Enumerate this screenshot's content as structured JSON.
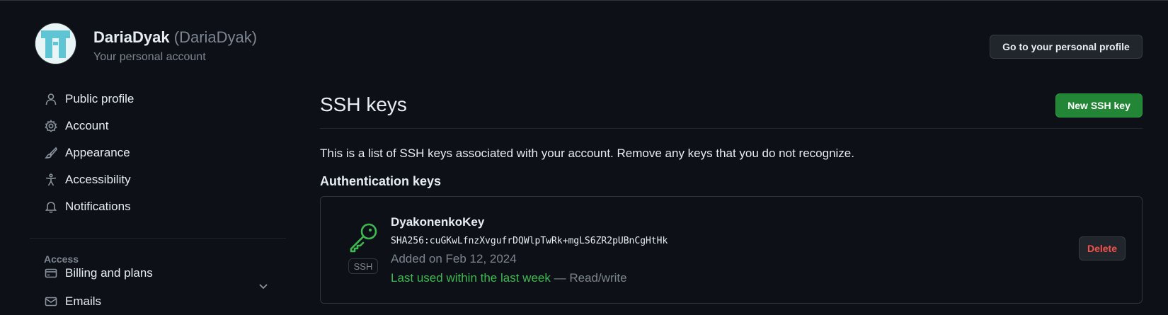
{
  "header": {
    "user_name": "DariaDyak",
    "user_login": "(DariaDyak)",
    "subtitle": "Your personal account",
    "profile_button": "Go to your personal profile"
  },
  "sidebar": {
    "items": [
      {
        "label": "Public profile",
        "icon": "person-icon"
      },
      {
        "label": "Account",
        "icon": "gear-icon"
      },
      {
        "label": "Appearance",
        "icon": "paintbrush-icon"
      },
      {
        "label": "Accessibility",
        "icon": "accessibility-icon"
      },
      {
        "label": "Notifications",
        "icon": "bell-icon"
      }
    ],
    "access_heading": "Access",
    "access_items": [
      {
        "label": "Billing and plans",
        "icon": "credit-card-icon"
      },
      {
        "label": "Emails",
        "icon": "mail-icon"
      }
    ]
  },
  "main": {
    "title": "SSH keys",
    "new_button": "New SSH key",
    "intro": "This is a list of SSH keys associated with your account. Remove any keys that you do not recognize.",
    "section_heading": "Authentication keys",
    "keys": [
      {
        "name": "DyakonenkoKey",
        "fingerprint": "SHA256:cuGKwLfnzXvgufrDQWlpTwRk+mgLS6ZR2pUBnCgHtHk",
        "added": "Added on Feb 12, 2024",
        "last_used": "Last used within the last week",
        "access": "— Read/write",
        "badge": "SSH",
        "delete_label": "Delete",
        "icon": "key-icon"
      }
    ]
  },
  "colors": {
    "background": "#0d1117",
    "text": "#e6edf3",
    "muted": "#7d8590",
    "border": "#30363d",
    "primary_button": "#238636",
    "success": "#3fb950",
    "danger": "#f85149"
  }
}
